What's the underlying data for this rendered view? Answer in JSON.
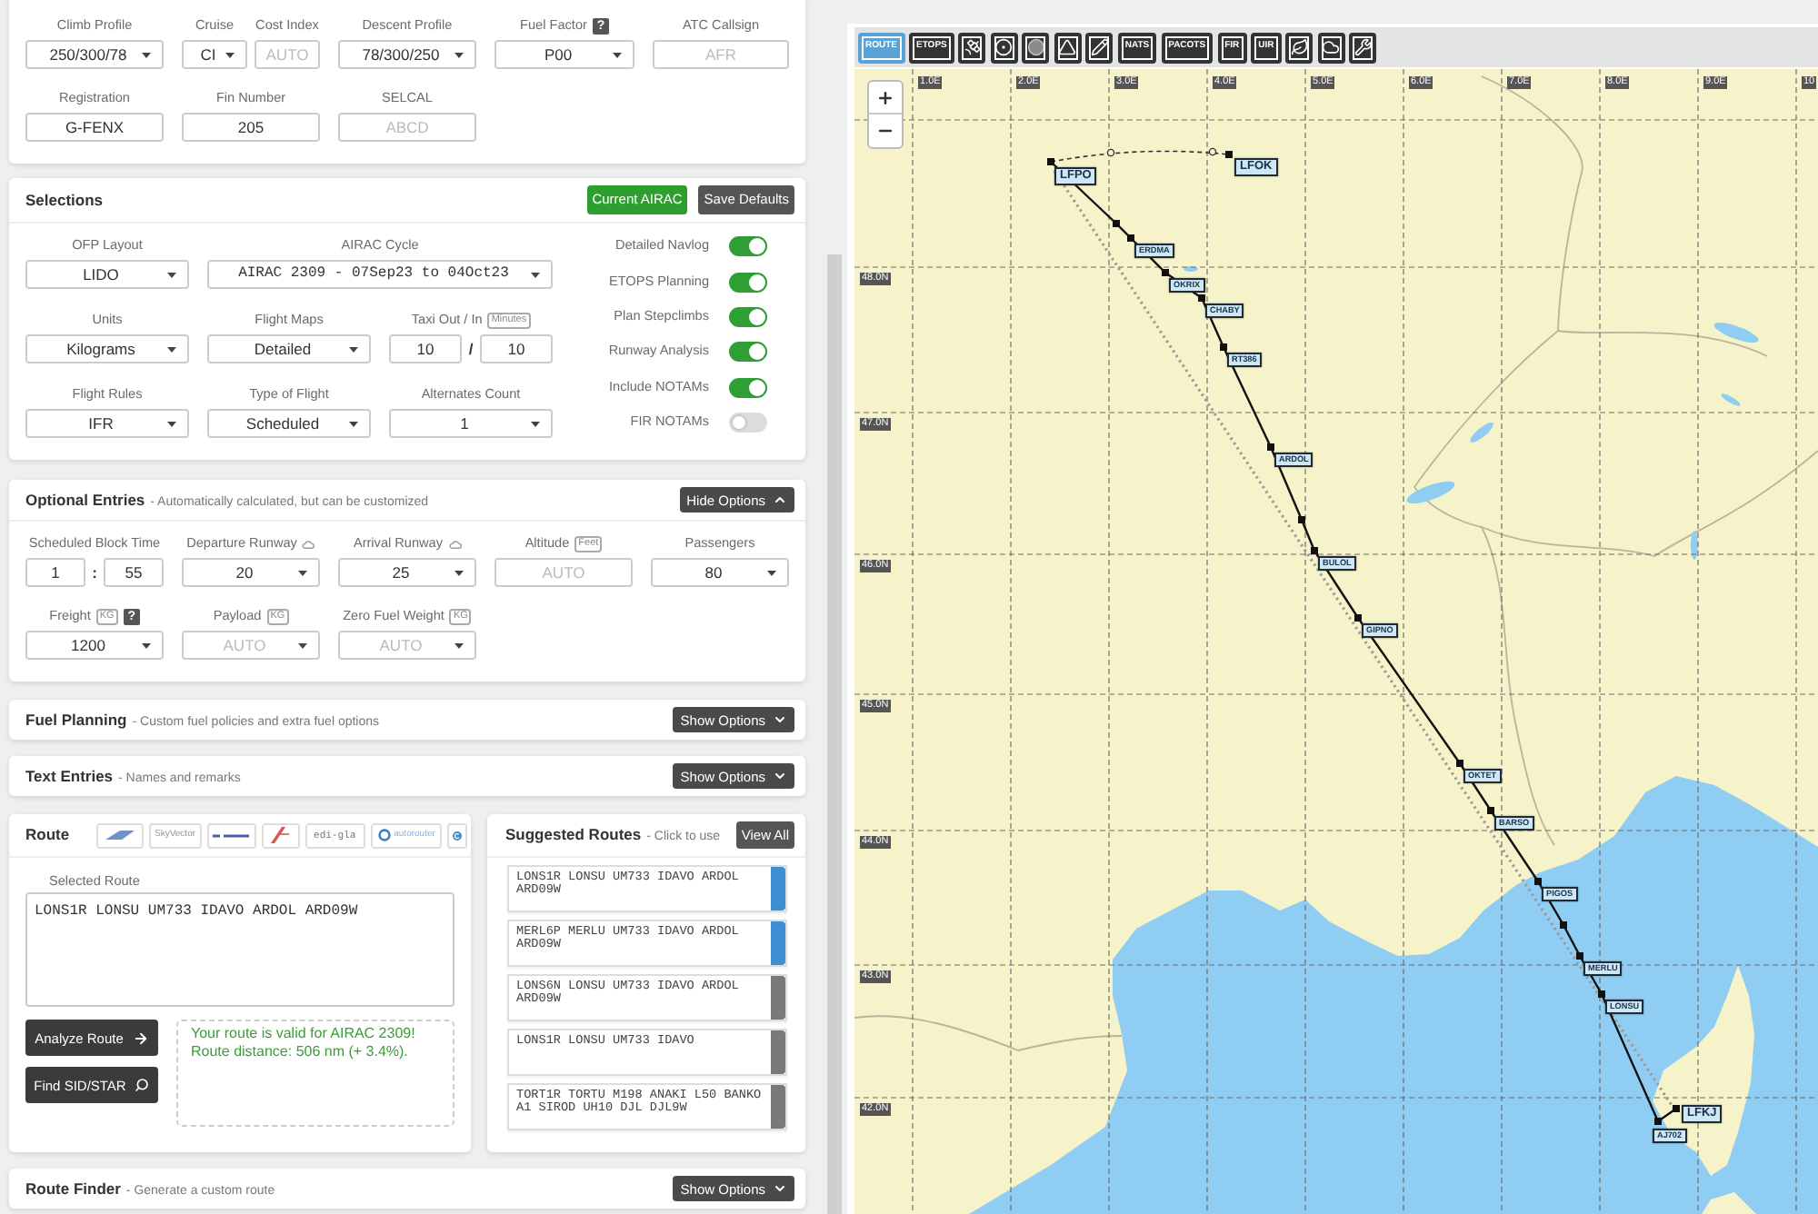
{
  "flight_details": {
    "rows": [
      [
        {
          "kind": "select",
          "label": "Climb Profile",
          "value": "250/300/78"
        },
        {
          "kind": "group",
          "fields": [
            {
              "kind": "select",
              "label": "Cruise",
              "value": "CI"
            },
            {
              "kind": "input",
              "label": "Cost Index",
              "placeholder": "AUTO"
            }
          ]
        },
        {
          "kind": "select",
          "label": "Descent Profile",
          "value": "78/300/250"
        },
        {
          "kind": "select",
          "label": "Fuel Factor",
          "help": "?",
          "value": "P00"
        },
        {
          "kind": "input",
          "label": "ATC Callsign",
          "placeholder": "AFR"
        }
      ],
      [
        {
          "kind": "input",
          "label": "Registration",
          "value": "G-FENX"
        },
        {
          "kind": "input",
          "label": "Fin Number",
          "value": "205"
        },
        {
          "kind": "input",
          "label": "SELCAL",
          "placeholder": "ABCD"
        }
      ]
    ]
  },
  "selections": {
    "title": "Selections",
    "buttons": [
      {
        "label": "Current AIRAC",
        "kind": "primary"
      },
      {
        "label": "Save Defaults",
        "kind": "secondary"
      }
    ],
    "rows": [
      [
        {
          "kind": "select",
          "label": "OFP Layout",
          "value": "LIDO"
        },
        {
          "kind": "code-select",
          "label": "AIRAC Cycle",
          "value": "AIRAC 2309 - 07Sep23 to 04Oct23"
        }
      ],
      [
        {
          "kind": "select",
          "label": "Units",
          "value": "Kilograms"
        },
        {
          "kind": "select",
          "label": "Flight Maps",
          "value": "Detailed"
        },
        {
          "kind": "pair",
          "label": "Taxi Out / In",
          "unit": "Minutes",
          "values": [
            "10",
            "10"
          ],
          "separator": "/"
        }
      ],
      [
        {
          "kind": "select",
          "label": "Flight Rules",
          "value": "IFR"
        },
        {
          "kind": "select",
          "label": "Type of Flight",
          "value": "Scheduled"
        },
        {
          "kind": "select",
          "label": "Alternates Count",
          "value": "1"
        }
      ]
    ],
    "toggles": [
      {
        "label": "Detailed Navlog",
        "on": true
      },
      {
        "label": "ETOPS Planning",
        "on": true
      },
      {
        "label": "Plan Stepclimbs",
        "on": true
      },
      {
        "label": "Runway Analysis",
        "on": true
      },
      {
        "label": "Include NOTAMs",
        "on": true
      },
      {
        "label": "FIR NOTAMs",
        "on": false
      }
    ]
  },
  "optional_entries": {
    "title": "Optional Entries",
    "subtitle": "- Automatically calculated, but can be customized",
    "toggle_button": {
      "label": "Hide Options",
      "expanded": true
    },
    "rows": [
      [
        {
          "kind": "pair",
          "label": "Scheduled Block Time",
          "values": [
            "1",
            "55"
          ],
          "separator": ":"
        },
        {
          "kind": "select",
          "label": "Departure Runway",
          "info": true,
          "value": "20"
        },
        {
          "kind": "select",
          "label": "Arrival Runway",
          "info": true,
          "value": "25"
        },
        {
          "kind": "input",
          "label": "Altitude",
          "unit": "Feet",
          "placeholder": "AUTO"
        },
        {
          "kind": "select",
          "label": "Passengers",
          "value": "80"
        }
      ],
      [
        {
          "kind": "select",
          "label": "Freight",
          "unit": "KG",
          "help": "?",
          "value": "1200"
        },
        {
          "kind": "select",
          "label": "Payload",
          "unit": "KG",
          "placeholder": "AUTO"
        },
        {
          "kind": "select",
          "label": "Zero Fuel Weight",
          "unit": "KG",
          "placeholder": "AUTO"
        }
      ]
    ]
  },
  "fuel_planning": {
    "title": "Fuel Planning",
    "subtitle": "- Custom fuel policies and extra fuel options",
    "toggle_button": {
      "label": "Show Options",
      "expanded": false
    }
  },
  "text_entries": {
    "title": "Text Entries",
    "subtitle": "- Names and remarks",
    "toggle_button": {
      "label": "Show Options",
      "expanded": false
    }
  },
  "route": {
    "title": "Route",
    "services": [
      {
        "kind": "wing"
      },
      {
        "kind": "text",
        "label": "SkyVector"
      },
      {
        "kind": "stripe"
      },
      {
        "kind": "slash"
      },
      {
        "kind": "mono",
        "label": "edi-gla"
      },
      {
        "kind": "ring",
        "label": "autorouter"
      },
      {
        "kind": "circle"
      }
    ],
    "selected_route": {
      "label": "Selected Route",
      "value": "LONS1R LONSU UM733 IDAVO ARDOL ARD09W"
    },
    "buttons": [
      {
        "label": "Analyze Route",
        "kind": "arrow"
      },
      {
        "label": "Find SID/STAR",
        "kind": "search"
      }
    ],
    "message_lines": [
      "Your route is valid for AIRAC 2309!",
      "Route distance: 506 nm (+ 3.4%)."
    ]
  },
  "suggested_routes": {
    "title": "Suggested Routes",
    "subtitle": "- Click to use",
    "view_all": "View All",
    "routes": [
      {
        "text": "LONS1R LONSU UM733 IDAVO ARDOL ARD09W",
        "color": "#3d8fd1"
      },
      {
        "text": "MERL6P MERLU UM733 IDAVO ARDOL ARD09W",
        "color": "#3d8fd1"
      },
      {
        "text": "LONS6N LONSU UM733 IDAVO ARDOL ARD09W",
        "color": "#7a7a7a"
      },
      {
        "text": "LONS1R LONSU UM733 IDAVO",
        "color": "#7a7a7a"
      },
      {
        "text": "TORT1R TORTU M198 ANAKI L50 BANKO A1 SIROD UH10 DJL DJL9W",
        "color": "#7a7a7a"
      }
    ]
  },
  "route_finder": {
    "title": "Route Finder",
    "subtitle": "- Generate a custom route",
    "toggle_button": {
      "label": "Show Options",
      "expanded": false
    }
  },
  "map": {
    "toolbar": [
      {
        "kind": "text",
        "label": "ROUTE",
        "selected": true
      },
      {
        "kind": "text",
        "label": "ETOPS",
        "selected": false
      },
      {
        "kind": "satellite",
        "selected": false
      },
      {
        "kind": "target",
        "selected": false
      },
      {
        "kind": "disc",
        "selected": false
      },
      {
        "kind": "triangle",
        "selected": false
      },
      {
        "kind": "pencil",
        "selected": false
      },
      {
        "kind": "text",
        "label": "NATS",
        "selected": false
      },
      {
        "kind": "text",
        "label": "PACOTS",
        "selected": false
      },
      {
        "kind": "text",
        "label": "FIR",
        "selected": false
      },
      {
        "kind": "text",
        "label": "UIR",
        "selected": false
      },
      {
        "kind": "leaf",
        "selected": false
      },
      {
        "kind": "cloud",
        "selected": false
      },
      {
        "kind": "wrench",
        "selected": false
      }
    ],
    "longitude_labels": [
      "1.0E",
      "2.0E",
      "3.0E",
      "4.0E",
      "5.0E",
      "6.0E",
      "7.0E",
      "8.0E",
      "9.0E",
      "10"
    ],
    "latitude_labels": [
      "48.0N",
      "47.0N",
      "46.0N",
      "45.0N",
      "44.0N",
      "43.0N",
      "42.0N"
    ],
    "waypoints": [
      {
        "label": "LFPO",
        "kind": "airport"
      },
      {
        "label": "ERDMA",
        "kind": "fix"
      },
      {
        "label": "OKRIX",
        "kind": "fix"
      },
      {
        "label": "CHABY",
        "kind": "fix"
      },
      {
        "label": "RT386",
        "kind": "fix"
      },
      {
        "label": "ARDOL",
        "kind": "fix"
      },
      {
        "label": "BULOL",
        "kind": "fix"
      },
      {
        "label": "GIPNO",
        "kind": "fix"
      },
      {
        "label": "OKTET",
        "kind": "fix"
      },
      {
        "label": "BARSO",
        "kind": "fix"
      },
      {
        "label": "PIGOS",
        "kind": "fix"
      },
      {
        "label": "MERLU",
        "kind": "fix"
      },
      {
        "label": "LONSU",
        "kind": "fix"
      },
      {
        "label": "AJ702",
        "kind": "fix"
      },
      {
        "label": "LFKJ",
        "kind": "airport"
      }
    ],
    "alternate": {
      "label": "LFOK"
    }
  }
}
